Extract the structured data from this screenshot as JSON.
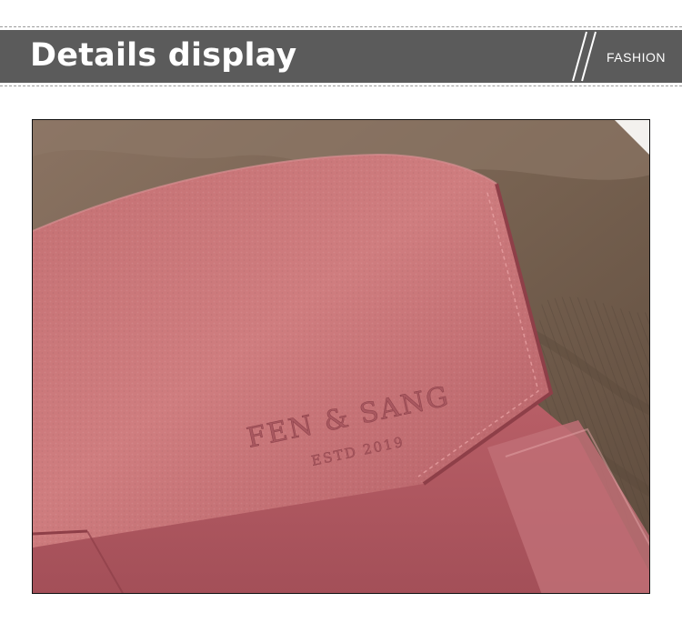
{
  "header": {
    "title": "Details display",
    "tag": "FASHION"
  },
  "photo": {
    "brand_emboss": "FEN & SANG",
    "brand_sub": "ESTD 2019",
    "colors": {
      "leather": "#c96e72",
      "leather_dark": "#9e4f55",
      "fabric": "#76614f",
      "fabric_light": "#8e7a69"
    }
  }
}
